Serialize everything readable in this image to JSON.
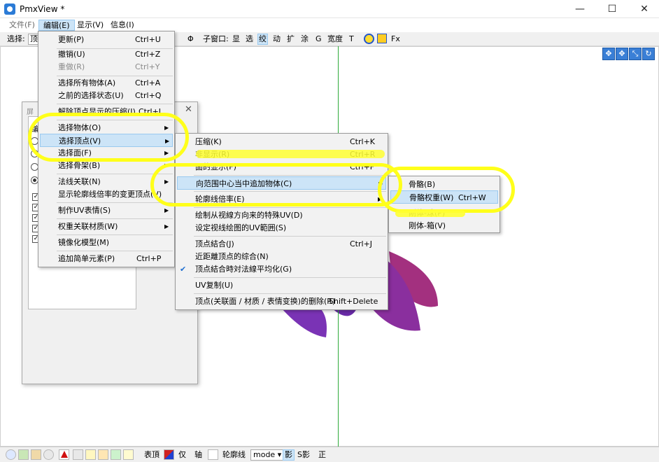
{
  "window": {
    "title": "PmxView *",
    "minimize": "—",
    "maximize": "☐",
    "close": "✕"
  },
  "menubar": {
    "file": "文件(F)",
    "edit": "编辑(E)",
    "display": "显示(V)",
    "info": "信息(I)"
  },
  "toolbar": {
    "select_label": "选择:",
    "select_value": "顶",
    "phi": "Φ",
    "subwindow_label": "子窗口:",
    "items": [
      "显",
      "选",
      "绞",
      "动",
      "扩",
      "涂",
      "G",
      "宽度",
      "T"
    ],
    "fx": "Fx"
  },
  "edit_menu": {
    "items": [
      {
        "label": "更新(P)",
        "shortcut": "Ctrl+U"
      },
      {
        "label": "撤销(U)",
        "shortcut": "Ctrl+Z"
      },
      {
        "label": "重做(R)",
        "shortcut": "Ctrl+Y"
      },
      {
        "label": "选择所有物体(A)",
        "shortcut": "Ctrl+A"
      },
      {
        "label": "之前的选择状态(U)",
        "shortcut": "Ctrl+Q"
      },
      {
        "label": "解除顶点显示的压缩(J)",
        "shortcut": "Ctrl+I"
      },
      {
        "label": "选择物体(O)",
        "shortcut": ""
      },
      {
        "label": "选择顶点(V)",
        "shortcut": ""
      },
      {
        "label": "选择面(F)",
        "shortcut": ""
      },
      {
        "label": "选择骨架(B)",
        "shortcut": ""
      },
      {
        "label": "法线关联(N)",
        "shortcut": ""
      },
      {
        "label": "显示轮廓线倍率的变更顶点(V)",
        "shortcut": ""
      },
      {
        "label": "制作UV表情(S)",
        "shortcut": ""
      },
      {
        "label": "权重关联材质(W)",
        "shortcut": ""
      },
      {
        "label": "镜像化模型(M)",
        "shortcut": ""
      },
      {
        "label": "追加简单元素(P)",
        "shortcut": "Ctrl+P"
      }
    ]
  },
  "vertex_menu": {
    "items": [
      {
        "label": "压缩(K)",
        "shortcut": "Ctrl+K"
      },
      {
        "label": "非显示(R)",
        "shortcut": "Ctrl+R"
      },
      {
        "label": "面的显示(F)",
        "shortcut": "Ctrl+F"
      },
      {
        "label": "向范围中心当中追加物体(C)",
        "shortcut": ""
      },
      {
        "label": "轮廓线倍率(E)",
        "shortcut": ""
      },
      {
        "label": "绘制从视線方向来的特殊UV(D)",
        "shortcut": ""
      },
      {
        "label": "设定视线绘图的UV範囲(S)",
        "shortcut": ""
      },
      {
        "label": "顶点結合(J)",
        "shortcut": "Ctrl+J"
      },
      {
        "label": "近距離顶点的综合(N)",
        "shortcut": ""
      },
      {
        "label": "顶点結合時対法線平均化(G)",
        "shortcut": ""
      },
      {
        "label": "UV复制(U)",
        "shortcut": ""
      },
      {
        "label": "顶点(关联面 / 材质 / 表情变换)的删除(R)",
        "shortcut": "Shift+Delete"
      }
    ]
  },
  "add_object_menu": {
    "items": [
      {
        "label": "骨骼(B)",
        "shortcut": ""
      },
      {
        "label": "骨骼权重(W)",
        "shortcut": "Ctrl+W"
      },
      {
        "label": "刚体-球(P)",
        "shortcut": ""
      },
      {
        "label": "刚体-箱(V)",
        "shortcut": ""
      }
    ]
  },
  "dialog": {
    "title": "屏",
    "close": "✕",
    "edit_label": "编"
  },
  "statusbar": {
    "face_top": "表頂",
    "only": "仅",
    "axis": "轴",
    "outline": "轮廓线",
    "mode": "mode ▾",
    "shadow": "影",
    "sshadow": "S影",
    "ortho": "正"
  },
  "colors": {
    "highlight_yellow": "#ffff1a",
    "selection_blue": "#cce4f7",
    "model_purple": "#8a2f9e"
  }
}
